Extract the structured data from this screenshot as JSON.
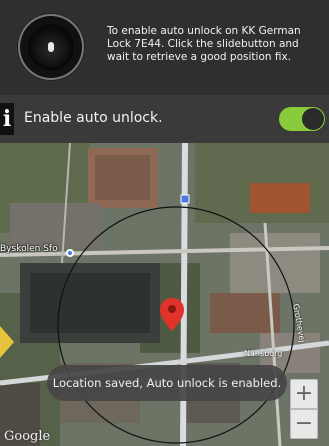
{
  "header": {
    "message": "To enable auto unlock on KK German Lock 7E44. Click the slidebutton and wait to retrieve a good position fix.",
    "icon": "lock-icon"
  },
  "toggle": {
    "info_glyph": "i",
    "label": "Enable auto unlock.",
    "state": "on",
    "color": "#8acb3d"
  },
  "map": {
    "place_label": "Byskolen Sfo",
    "street_label_1": "Nansborg",
    "street_label_2": "Grothevej",
    "attribution": "Google",
    "zoom_in": "+",
    "zoom_out": "−"
  },
  "toast": {
    "text": "Location saved, Auto unlock is enabled."
  }
}
